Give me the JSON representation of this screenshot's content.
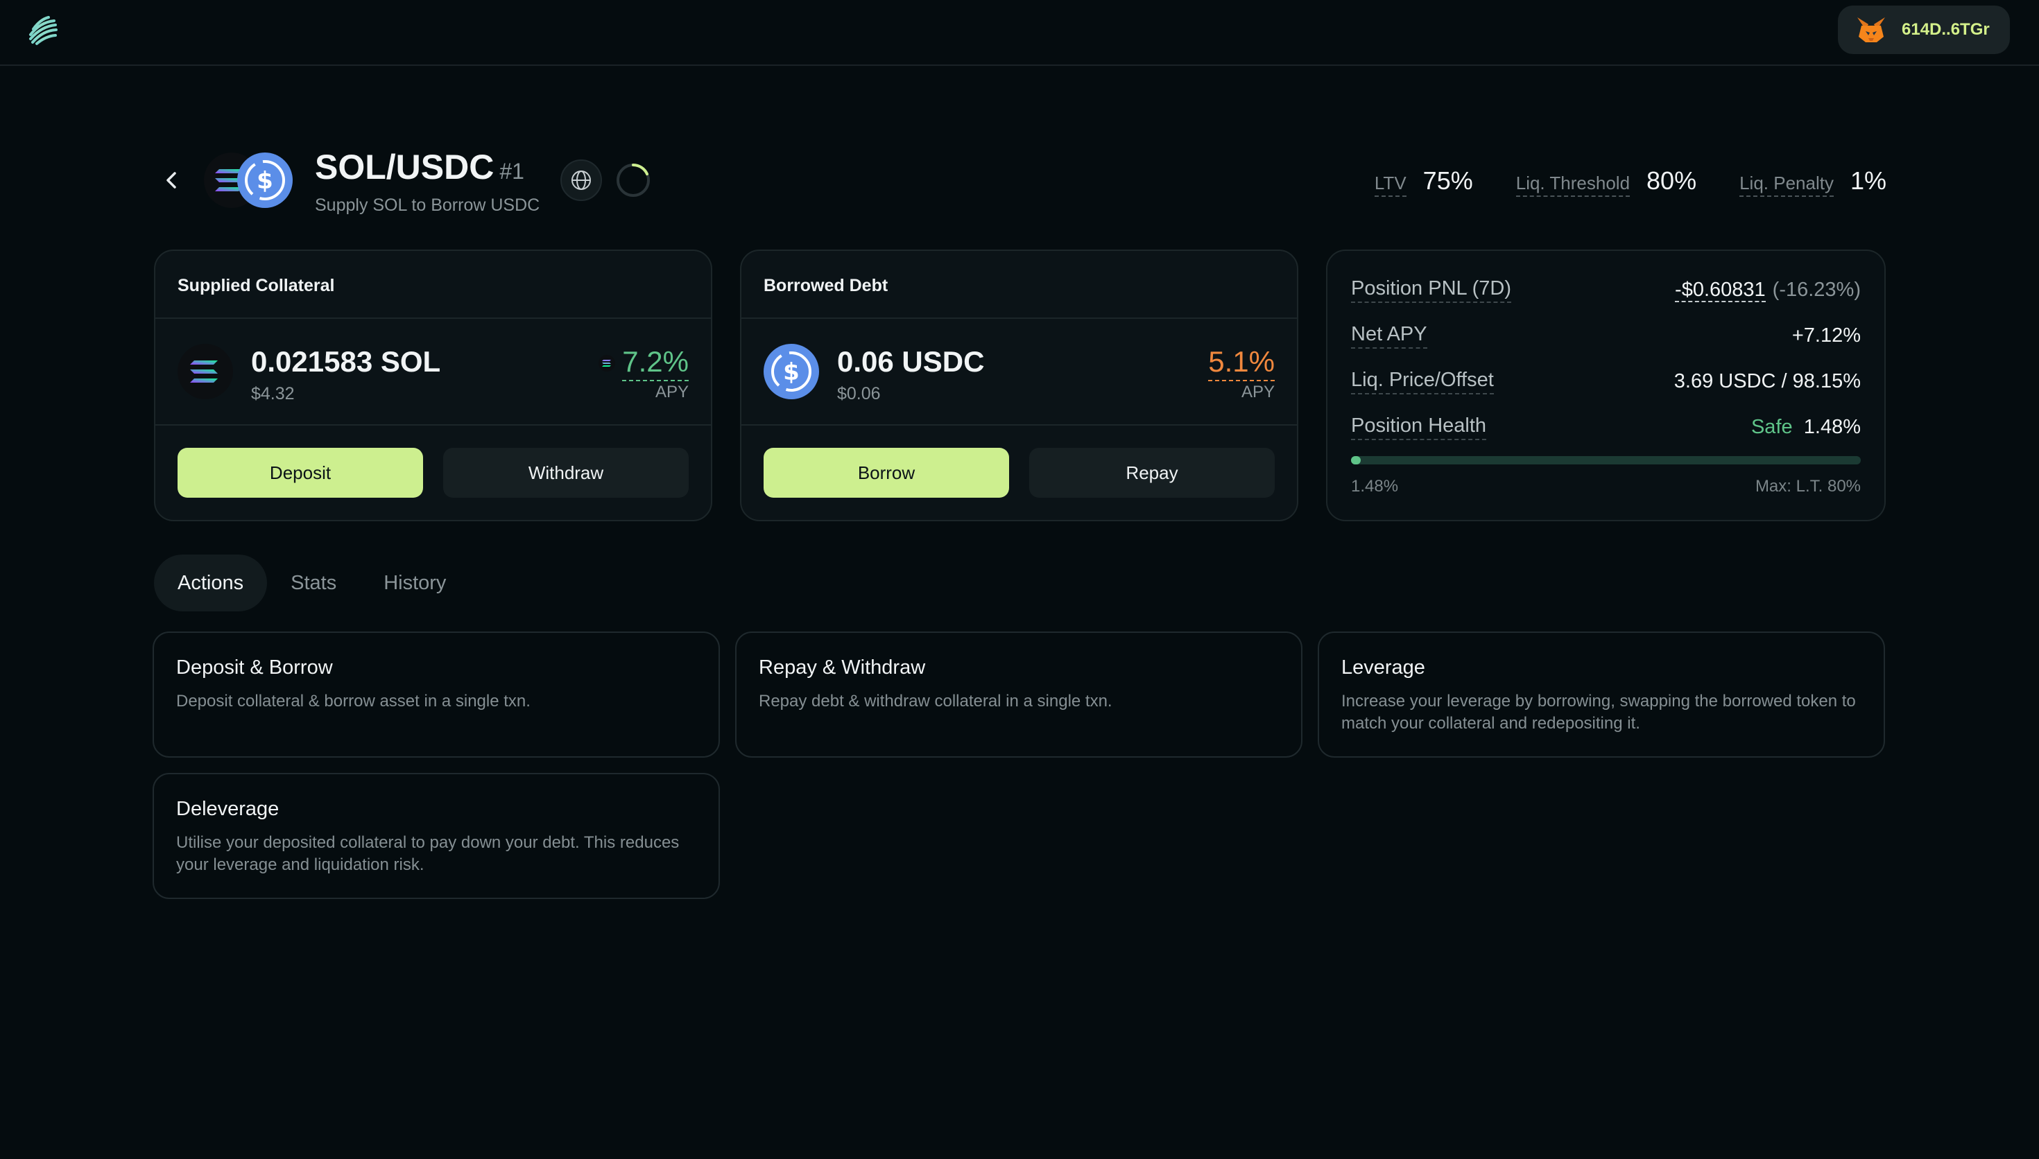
{
  "topbar": {
    "logo_icon": "striped-globe-logo",
    "wallet": {
      "icon": "metamask-fox-icon",
      "address": "614D..6TGr"
    }
  },
  "pair": {
    "title": "SOL/USDC",
    "rank": "#1",
    "subtitle": "Supply SOL to Borrow USDC",
    "icons": [
      "solana-icon",
      "usdc-icon"
    ]
  },
  "metrics": [
    {
      "label": "LTV",
      "value": "75%"
    },
    {
      "label": "Liq. Threshold",
      "value": "80%"
    },
    {
      "label": "Liq. Penalty",
      "value": "1%"
    }
  ],
  "collateral": {
    "title": "Supplied Collateral",
    "amount": "0.021583 SOL",
    "usd": "$4.32",
    "apy": "7.2%",
    "apy_label": "APY",
    "apy_color": "#5fc489",
    "buttons": {
      "primary": "Deposit",
      "secondary": "Withdraw"
    }
  },
  "debt": {
    "title": "Borrowed Debt",
    "amount": "0.06 USDC",
    "usd": "$0.06",
    "apy": "5.1%",
    "apy_label": "APY",
    "apy_color": "#f0883e",
    "buttons": {
      "primary": "Borrow",
      "secondary": "Repay"
    }
  },
  "position": {
    "pnl_label": "Position PNL (7D)",
    "pnl_value": "-$0.60831",
    "pnl_pct": "(-16.23%)",
    "net_apy_label": "Net APY",
    "net_apy_value": "+7.12%",
    "liq_label": "Liq. Price/Offset",
    "liq_value": "3.69 USDC / 98.15%",
    "health_label": "Position Health",
    "health_status": "Safe",
    "health_value": "1.48%",
    "health_fraction": 0.0185,
    "health_min_label": "1.48%",
    "health_max_label": "Max: L.T. 80%"
  },
  "tabs": [
    {
      "label": "Actions",
      "active": true
    },
    {
      "label": "Stats",
      "active": false
    },
    {
      "label": "History",
      "active": false
    }
  ],
  "actions": [
    {
      "title": "Deposit & Borrow",
      "desc": "Deposit collateral & borrow asset in a single txn."
    },
    {
      "title": "Repay & Withdraw",
      "desc": "Repay debt & withdraw collateral in a single txn."
    },
    {
      "title": "Leverage",
      "desc": "Increase your leverage by borrowing, swapping the borrowed token to match your collateral and redepositing it."
    },
    {
      "title": "Deleverage",
      "desc": "Utilise your deposited collateral to pay down your debt. This reduces your leverage and liquidation risk."
    }
  ]
}
